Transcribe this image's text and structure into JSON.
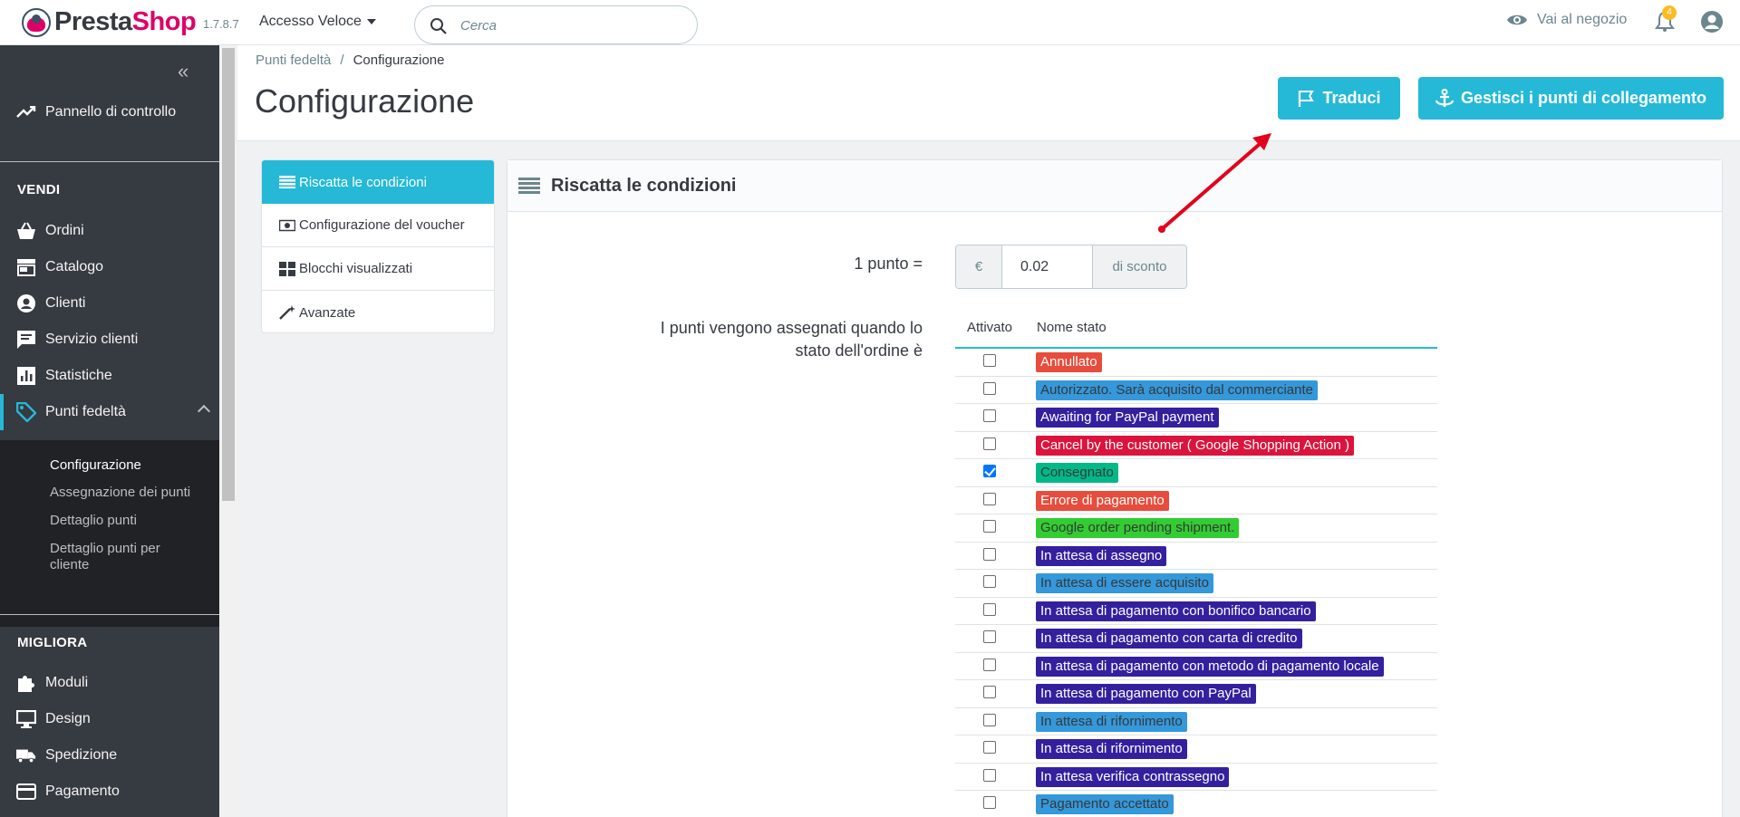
{
  "header": {
    "brand_part1": "Presta",
    "brand_part2": "Shop",
    "version": "1.7.8.7",
    "quick_access": "Accesso Veloce",
    "search_placeholder": "Cerca",
    "view_shop": "Vai al negozio",
    "notification_count": "4",
    "icons": [
      "search-icon",
      "eye-icon",
      "bell-icon",
      "user-icon"
    ]
  },
  "sidebar": {
    "dashboard": "Pannello di controllo",
    "sell_heading": "VENDI",
    "sell_items": [
      "Ordini",
      "Catalogo",
      "Clienti",
      "Servizio clienti",
      "Statistiche",
      "Punti fedeltà"
    ],
    "submenu": [
      "Configurazione",
      "Assegnazione dei punti",
      "Dettaglio punti",
      "Dettaglio punti per",
      "cliente"
    ],
    "improve_heading": "MIGLIORA",
    "improve_items": [
      "Moduli",
      "Design",
      "Spedizione",
      "Pagamento"
    ]
  },
  "breadcrumb": {
    "parent": "Punti fedeltà",
    "separator": "/",
    "current": "Configurazione"
  },
  "page_title": "Configurazione",
  "toolbar": {
    "translate": "Traduci",
    "hooks": "Gestisci i punti di collegamento"
  },
  "tabs": [
    "Riscatta le condizioni",
    "Configurazione del voucher",
    "Blocchi visualizzati",
    "Avanzate"
  ],
  "panel": {
    "title": "Riscatta le condizioni",
    "point_label": "1 punto =",
    "currency": "€",
    "point_value": "0.02",
    "discount_suffix": "di sconto",
    "status_label_1": "I punti vengono assegnati quando lo",
    "status_label_2": "stato dell'ordine è",
    "col_enabled": "Attivato",
    "col_name": "Nome stato",
    "statuses": [
      {
        "name": "Annullato",
        "checked": false,
        "color": "#e74c3c",
        "text": "#ffffff"
      },
      {
        "name": "Autorizzato. Sarà acquisito dal commerciante",
        "checked": false,
        "color": "#3498db",
        "text": "#383838"
      },
      {
        "name": "Awaiting for PayPal payment",
        "checked": false,
        "color": "#34209e",
        "text": "#ffffff"
      },
      {
        "name": "Cancel by the customer ( Google Shopping Action )",
        "checked": false,
        "color": "#dc143c",
        "text": "#ffffff"
      },
      {
        "name": "Consegnato",
        "checked": true,
        "color": "#01b887",
        "text": "#383838"
      },
      {
        "name": "Errore di pagamento",
        "checked": false,
        "color": "#e74c3c",
        "text": "#ffffff"
      },
      {
        "name": "Google order pending shipment.",
        "checked": false,
        "color": "#32cd32",
        "text": "#383838"
      },
      {
        "name": "In attesa di assegno",
        "checked": false,
        "color": "#34209e",
        "text": "#ffffff"
      },
      {
        "name": "In attesa di essere acquisito",
        "checked": false,
        "color": "#3498db",
        "text": "#383838"
      },
      {
        "name": "In attesa di pagamento con bonifico bancario",
        "checked": false,
        "color": "#34209e",
        "text": "#ffffff"
      },
      {
        "name": "In attesa di pagamento con carta di credito",
        "checked": false,
        "color": "#34209e",
        "text": "#ffffff"
      },
      {
        "name": "In attesa di pagamento con metodo di pagamento locale",
        "checked": false,
        "color": "#34209e",
        "text": "#ffffff"
      },
      {
        "name": "In attesa di pagamento con PayPal",
        "checked": false,
        "color": "#34209e",
        "text": "#ffffff"
      },
      {
        "name": "In attesa di rifornimento",
        "checked": false,
        "color": "#3498db",
        "text": "#383838"
      },
      {
        "name": "In attesa di rifornimento",
        "checked": false,
        "color": "#34209e",
        "text": "#ffffff"
      },
      {
        "name": "In attesa verifica contrassegno",
        "checked": false,
        "color": "#34209e",
        "text": "#ffffff"
      },
      {
        "name": "Pagamento accettato",
        "checked": false,
        "color": "#3498db",
        "text": "#383838"
      }
    ]
  },
  "colors": {
    "accent": "#25b9d7",
    "sidebar": "#363a41",
    "arrow": "#e3001b"
  }
}
